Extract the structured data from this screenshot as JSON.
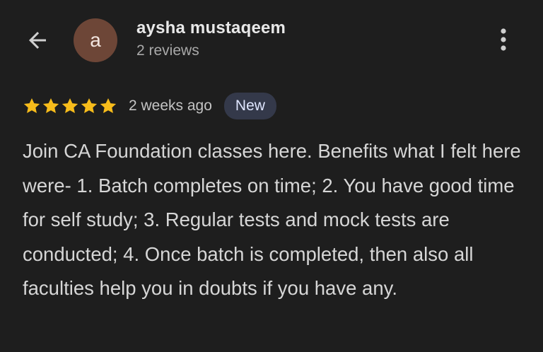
{
  "reviewer": {
    "avatar_initial": "a",
    "avatar_color": "#6d4637",
    "name": "aysha mustaqeem",
    "review_count": "2 reviews"
  },
  "icons": {
    "back": "arrow-left-icon",
    "more": "more-vert-icon",
    "star": "star-icon"
  },
  "review": {
    "rating": 5,
    "max_rating": 5,
    "star_color": "#f7bc1b",
    "time_ago": "2 weeks ago",
    "badge": "New",
    "text": "Join CA Foundation classes here. Benefits what I felt here were- 1. Batch completes on time; 2. You have good time for self study; 3. Regular tests and mock tests are conducted; 4. Once batch is completed, then also all faculties help you in doubts if you have any."
  }
}
